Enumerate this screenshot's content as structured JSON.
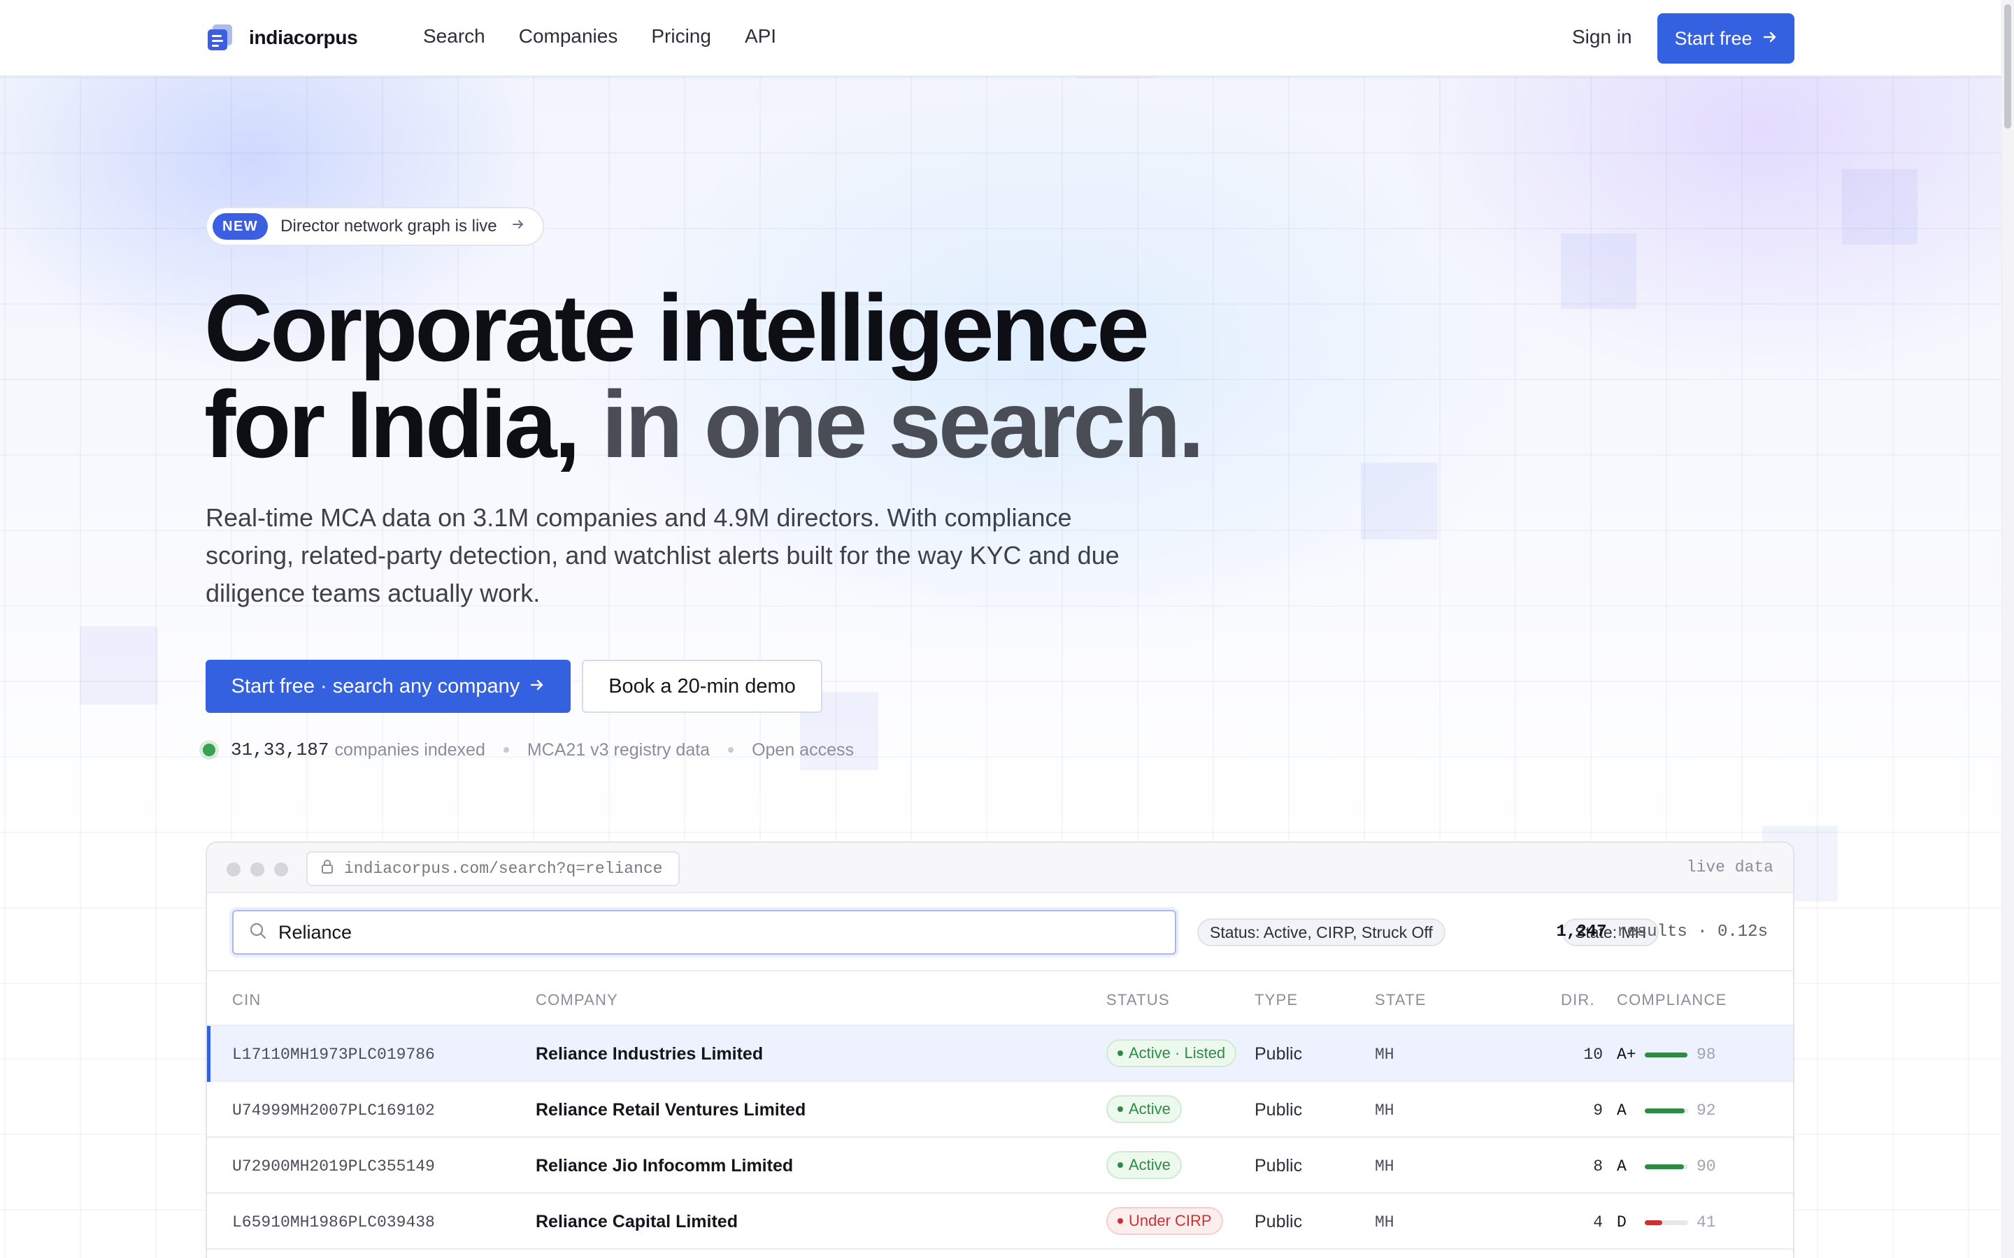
{
  "header": {
    "brand": "indiacorpus",
    "nav": [
      "Search",
      "Companies",
      "Pricing",
      "API"
    ],
    "signin": "Sign in",
    "start_label": "Start free"
  },
  "hero": {
    "badge": "NEW",
    "announcement": "Director network graph is live",
    "headline_line1": "Corporate intelligence",
    "headline_line2_a": "for India,",
    "headline_line2_b": "in one search.",
    "lede": "Real-time MCA data on 3.1M companies and 4.9M directors. With compliance scoring, related-party detection, and watchlist alerts built for the way KYC and due diligence teams actually work.",
    "cta_primary": "Start free · search any company",
    "cta_secondary": "Book a 20-min demo",
    "stats": {
      "count": "31,33,187",
      "count_label": "companies indexed",
      "source": "MCA21 v3 registry data",
      "access": "Open access"
    }
  },
  "app": {
    "url": "indiacorpus.com/search?q=reliance",
    "live": "live data",
    "search_value": "Reliance",
    "filters": [
      "Status: Active, CIRP, Struck Off",
      "State: MH"
    ],
    "results_count": "1,247",
    "results_suffix": "results · 0.12s",
    "columns": [
      "CIN",
      "COMPANY",
      "STATUS",
      "TYPE",
      "STATE",
      "DIR.",
      "COMPLIANCE"
    ],
    "rows": [
      {
        "cin": "L17110MH1973PLC019786",
        "company": "Reliance Industries Limited",
        "status": "Active · Listed",
        "status_kind": "ok",
        "type": "Public",
        "state": "MH",
        "dir": "10",
        "grade": "A+",
        "score": 98
      },
      {
        "cin": "U74999MH2007PLC169102",
        "company": "Reliance Retail Ventures Limited",
        "status": "Active",
        "status_kind": "ok",
        "type": "Public",
        "state": "MH",
        "dir": "9",
        "grade": "A",
        "score": 92
      },
      {
        "cin": "U72900MH2019PLC355149",
        "company": "Reliance Jio Infocomm Limited",
        "status": "Active",
        "status_kind": "ok",
        "type": "Public",
        "state": "MH",
        "dir": "8",
        "grade": "A",
        "score": 90
      },
      {
        "cin": "L65910MH1986PLC039438",
        "company": "Reliance Capital Limited",
        "status": "Under CIRP",
        "status_kind": "bad",
        "type": "Public",
        "state": "MH",
        "dir": "4",
        "grade": "D",
        "score": 41
      }
    ]
  },
  "colors": {
    "accent": "#3461e0",
    "ok": "#2f8a45",
    "bad": "#c83232"
  }
}
